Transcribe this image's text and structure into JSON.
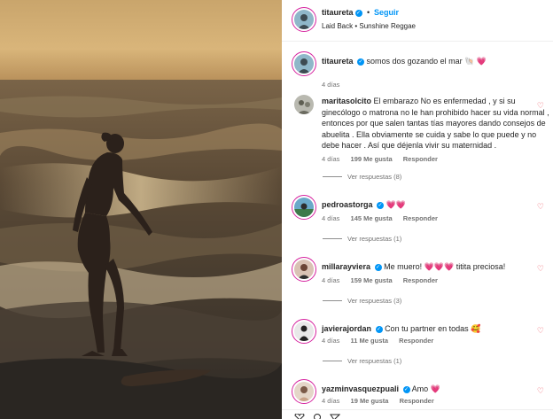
{
  "post": {
    "author": "titaureta",
    "follow_label": "Seguir",
    "separator": "•",
    "song": "Laid Back • Sunshine Reggae"
  },
  "caption": {
    "user": "titaureta",
    "text": "somos dos gozando el mar",
    "emoji": "🐚 💗",
    "age": "4 días"
  },
  "comments": [
    {
      "user": "maritasolcito",
      "text": "El embarazo No es enfermedad , y si su ginecólogo o matrona no le han prohibido hacer su vida normal , entonces por que salen tantas tías mayores dando consejos de abuelita . Ella obviamente se cuida y sabe lo que puede y no debe hacer . Así que déjenla vivir su maternidad .",
      "age": "4 días",
      "likes": "199 Me gusta",
      "reply": "Responder",
      "view_replies": "Ver respuestas (8)"
    },
    {
      "user": "pedroastorga",
      "text": "💗💗",
      "age": "4 días",
      "likes": "145 Me gusta",
      "reply": "Responder",
      "view_replies": "Ver respuestas (1)"
    },
    {
      "user": "millarayviera",
      "text": "Me muero! 💗💗💗 titita preciosa!",
      "age": "4 días",
      "likes": "159 Me gusta",
      "reply": "Responder",
      "view_replies": "Ver respuestas (3)"
    },
    {
      "user": "javierajordan",
      "text": "Con tu partner en todas 🥰",
      "age": "4 días",
      "likes": "11 Me gusta",
      "reply": "Responder",
      "view_replies": "Ver respuestas (1)"
    },
    {
      "user": "yazminvasquezpuali",
      "text": "Amo 💗",
      "age": "4 días",
      "likes": "19 Me gusta",
      "reply": "Responder"
    }
  ],
  "colors": {
    "accent": "#0095f6",
    "heart": "#ed4956",
    "muted": "#737373"
  }
}
